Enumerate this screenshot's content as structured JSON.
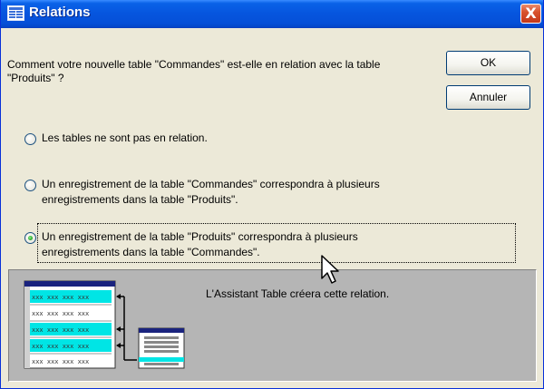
{
  "window": {
    "title": "Relations",
    "close_symbol": "X",
    "title_icon": "table-icon"
  },
  "question": "Comment votre nouvelle table \"Commandes\" est-elle en relation avec la table \"Produits\" ?",
  "buttons": {
    "ok_label": "OK",
    "cancel_label": "Annuler"
  },
  "options": [
    {
      "line1": "Les tables ne sont pas en relation.",
      "line2": "",
      "selected": false
    },
    {
      "line1": "Un enregistrement de la table \"Commandes\" correspondra à plusieurs",
      "line2": "enregistrements dans la table \"Produits\".",
      "selected": false
    },
    {
      "line1": "Un enregistrement de la table \"Produits\" correspondra à plusieurs",
      "line2": "enregistrements dans la table \"Commandes\".",
      "selected": true
    }
  ],
  "preview": {
    "caption": "L'Assistant Table créera cette relation.",
    "cell_text": "xxx xxx xxx xxx",
    "highlight_color": "#00e5e5",
    "header_color": "#1a237e"
  }
}
